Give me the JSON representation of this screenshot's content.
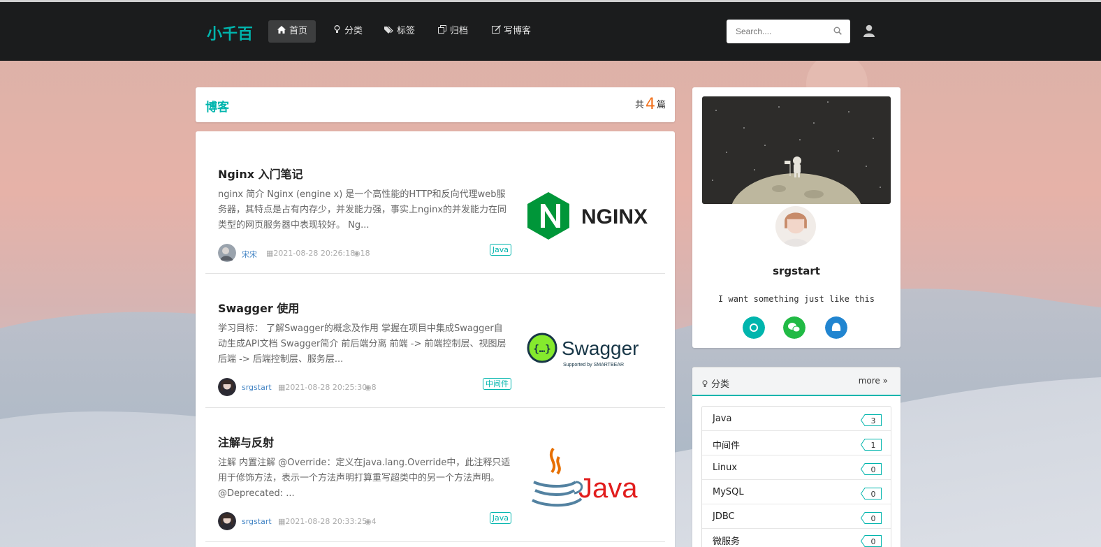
{
  "nav": {
    "brand": "小千百",
    "items": [
      {
        "label": "首页",
        "icon": "home-icon"
      },
      {
        "label": "分类",
        "icon": "lightbulb-icon"
      },
      {
        "label": "标签",
        "icon": "tags-icon"
      },
      {
        "label": "归档",
        "icon": "clone-icon"
      },
      {
        "label": "写博客",
        "icon": "edit-icon"
      }
    ],
    "search_placeholder": "Search...."
  },
  "blog_header": {
    "title": "博客",
    "count_prefix": "共",
    "count": "4",
    "count_suffix": "篇"
  },
  "posts": [
    {
      "title": "Nginx 入门笔记",
      "excerpt": "nginx 简介 Nginx (engine x) 是一个高性能的HTTP和反向代理web服务器，其特点是占有内存少，并发能力强，事实上nginx的并发能力在同类型的网页服务器中表现较好。 Ng...",
      "author": "宋宋",
      "date": "2021-08-28 20:26:18",
      "views": "18",
      "tag": "Java",
      "thumb_text": "NGINX"
    },
    {
      "title": "Swagger 使用",
      "excerpt": "学习目标： 了解Swagger的概念及作用 掌握在项目中集成Swagger自动生成API文档 Swagger简介 前后端分离 前端 -> 前端控制层、视图层 后端 -> 后端控制层、服务层...",
      "author": "srgstart",
      "date": "2021-08-28 20:25:30",
      "views": "8",
      "tag": "中间件",
      "thumb_text": "Swagger",
      "thumb_sub": "Supported by SMARTBEAR"
    },
    {
      "title": "注解与反射",
      "excerpt": "注解 内置注解 @Override：定义在java.lang.Override中，此注释只适用于修饰方法，表示一个方法声明打算重写超类中的另一个方法声明。 @Deprecated: ...",
      "author": "srgstart",
      "date": "2021-08-28 20:33:25",
      "views": "4",
      "tag": "Java",
      "thumb_text": "Java"
    }
  ],
  "profile": {
    "name": "srgstart",
    "motto": "I want something just like this",
    "social": [
      {
        "icon": "github-icon",
        "color": "#00b5ad"
      },
      {
        "icon": "wechat-icon",
        "color": "#21ba45"
      },
      {
        "icon": "qq-icon",
        "color": "#2185d0"
      }
    ]
  },
  "categories": {
    "title": "分类",
    "more": "more",
    "items": [
      {
        "name": "Java",
        "count": "3"
      },
      {
        "name": "中间件",
        "count": "1"
      },
      {
        "name": "Linux",
        "count": "0"
      },
      {
        "name": "MySQL",
        "count": "0"
      },
      {
        "name": "JDBC",
        "count": "0"
      },
      {
        "name": "微服务",
        "count": "0"
      }
    ]
  },
  "colors": {
    "accent": "#00b5ad",
    "navbar": "#1b1c1d",
    "count_highlight": "#f2711c",
    "link": "#4183c4"
  }
}
